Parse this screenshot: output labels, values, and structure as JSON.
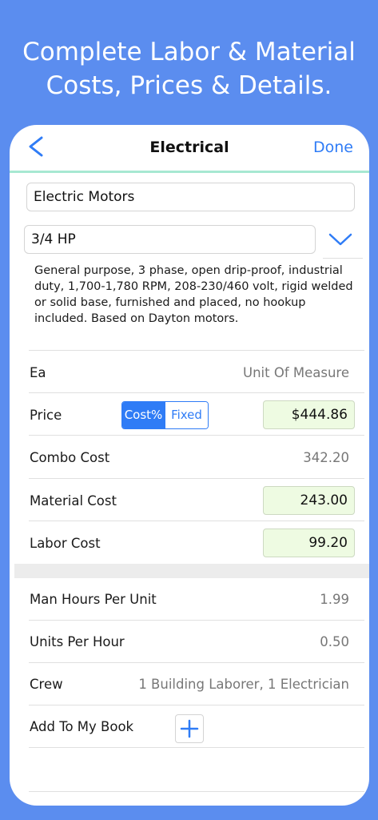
{
  "headline": {
    "line1": "Complete Labor & Material",
    "line2": "Costs, Prices & Details."
  },
  "navbar": {
    "back_label": "<",
    "title": "Electrical",
    "done_label": "Done"
  },
  "item": {
    "name": "Electric Motors",
    "size": "3/4  HP",
    "description": "General purpose, 3 phase, open drip-proof, industrial duty, 1,700-1,780 RPM, 208-230/460 volt, rigid welded or solid base, furnished and placed, no hookup included. Based on Dayton motors."
  },
  "details": {
    "unit": "Ea",
    "unit_label": "Unit Of Measure",
    "price_label": "Price",
    "price_mode_options": [
      "Cost%",
      "Fixed"
    ],
    "price_mode_selected": "Cost%",
    "price_value": "$444.86",
    "combo_label": "Combo Cost",
    "combo_value": "342.20",
    "material_label": "Material Cost",
    "material_value": "243.00",
    "labor_label": "Labor Cost",
    "labor_value": "99.20",
    "man_hours_label": "Man Hours Per Unit",
    "man_hours_value": "1.99",
    "units_per_hour_label": "Units Per Hour",
    "units_per_hour_value": "0.50",
    "crew_label": "Crew",
    "crew_value": "1 Building Laborer, 1 Electrician",
    "add_label": "Add To My Book"
  },
  "colors": {
    "background": "#5b8def",
    "accent": "#2f7cf6",
    "nav_underline": "#a7e8d2",
    "editable_field": "#eefbe2"
  },
  "icons": {
    "back": "chevron-left-icon",
    "dropdown": "chevron-down-icon",
    "add": "plus-icon"
  }
}
